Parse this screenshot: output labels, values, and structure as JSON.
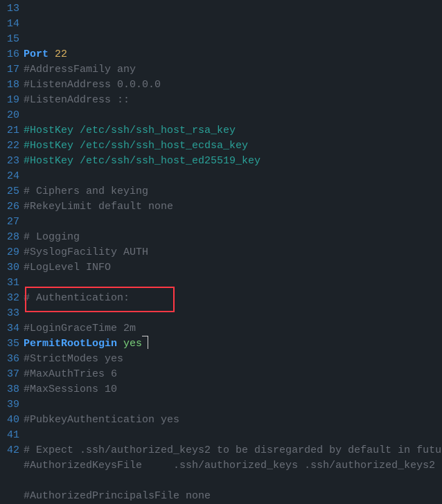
{
  "first_line_number": 13,
  "highlight_row_index": 19,
  "lines": [
    [
      {
        "type": "kw",
        "text": "Port"
      },
      {
        "type": "sp",
        "text": " "
      },
      {
        "type": "num",
        "text": "22"
      }
    ],
    [
      {
        "type": "c",
        "text": "#AddressFamily any"
      }
    ],
    [
      {
        "type": "c",
        "text": "#ListenAddress 0.0.0.0"
      }
    ],
    [
      {
        "type": "c",
        "text": "#ListenAddress ::"
      }
    ],
    [],
    [
      {
        "type": "cTeal",
        "text": "#HostKey /etc/ssh/ssh_host_rsa_key"
      }
    ],
    [
      {
        "type": "cTeal",
        "text": "#HostKey /etc/ssh/ssh_host_ecdsa_key"
      }
    ],
    [
      {
        "type": "cTeal",
        "text": "#HostKey /etc/ssh/ssh_host_ed25519_key"
      }
    ],
    [],
    [
      {
        "type": "c",
        "text": "# Ciphers and keying"
      }
    ],
    [
      {
        "type": "c",
        "text": "#RekeyLimit default none"
      }
    ],
    [],
    [
      {
        "type": "c",
        "text": "# Logging"
      }
    ],
    [
      {
        "type": "c",
        "text": "#SyslogFacility AUTH"
      }
    ],
    [
      {
        "type": "c",
        "text": "#LogLevel INFO"
      }
    ],
    [],
    [
      {
        "type": "c",
        "text": "# Authentication:"
      }
    ],
    [],
    [
      {
        "type": "c",
        "text": "#LoginGraceTime 2m"
      }
    ],
    [
      {
        "type": "kw",
        "text": "PermitRootLogin"
      },
      {
        "type": "sp",
        "text": " "
      },
      {
        "type": "val",
        "text": "yes"
      },
      {
        "type": "cursor"
      }
    ],
    [
      {
        "type": "c",
        "text": "#StrictModes yes"
      }
    ],
    [
      {
        "type": "c",
        "text": "#MaxAuthTries 6"
      }
    ],
    [
      {
        "type": "c",
        "text": "#MaxSessions 10"
      }
    ],
    [],
    [
      {
        "type": "c",
        "text": "#PubkeyAuthentication yes"
      }
    ],
    [],
    [
      {
        "type": "c",
        "text": "# Expect .ssh/authorized_keys2 to be disregarded by default in futu"
      }
    ],
    [
      {
        "type": "c",
        "text": "#AuthorizedKeysFile     .ssh/authorized_keys .ssh/authorized_keys2"
      }
    ],
    [],
    [
      {
        "type": "c",
        "text": "#AuthorizedPrincipalsFile none"
      }
    ]
  ]
}
